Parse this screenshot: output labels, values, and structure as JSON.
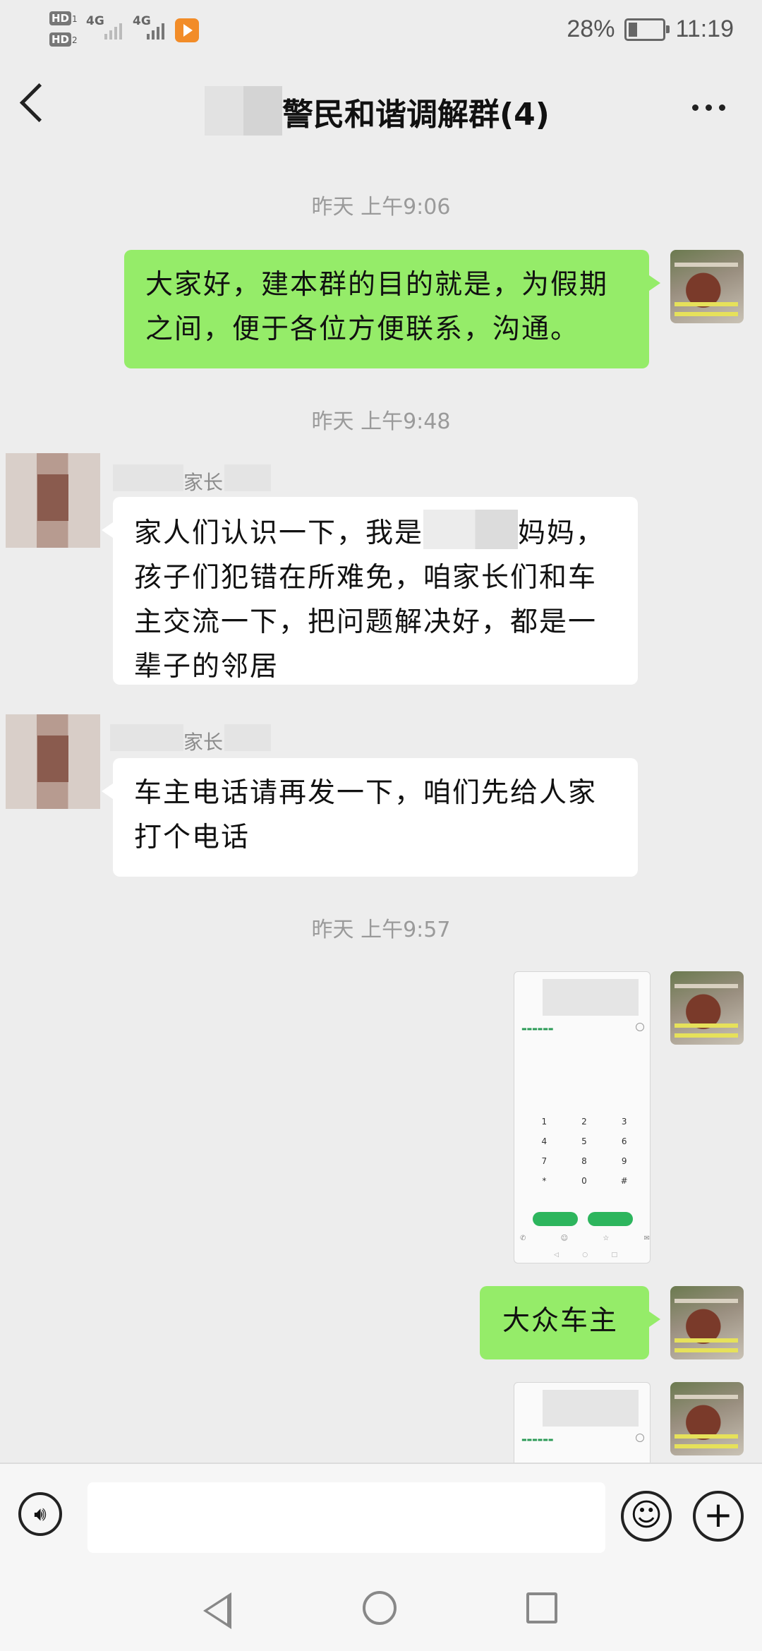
{
  "status_bar": {
    "sim1": "HD",
    "sim1_index": "1",
    "sim2": "HD",
    "sim2_index": "2",
    "net1": "4G",
    "net2": "4G",
    "battery_percent": "28%",
    "battery_level": 0.28,
    "time": "11:19"
  },
  "header": {
    "title": "警民和谐调解群(4)"
  },
  "messages": {
    "t1": "昨天 上午9:06",
    "m1": "大家好，建本群的目的就是，为假期之间，便于各位方便联系，沟通。",
    "t2": "昨天 上午9:48",
    "m2_sender": "家长",
    "m2_part1": "家人们认识一下，我是",
    "m2_part2": "妈妈，孩子们犯错在所难免，咱家长们和车主交流一下，把问题解决好，都是一辈子的邻居",
    "m3_sender": "家长",
    "m3": "车主电话请再发一下，咱们先给人家打个电话",
    "t3": "昨天 上午9:57",
    "m5": "大众车主"
  },
  "keypad_keys": [
    "1",
    "2",
    "3",
    "4",
    "5",
    "6",
    "7",
    "8",
    "9",
    "*",
    "0",
    "#"
  ],
  "colors": {
    "chat_bg": "#ededed",
    "self_bubble": "#95ec69",
    "other_bubble": "#ffffff",
    "timestamp": "#9a9a9a"
  },
  "icons": {
    "back": "chevron-left-icon",
    "more": "more-dots-icon",
    "voice": "voice-icon",
    "emoji": "emoji-icon",
    "plus": "plus-icon"
  }
}
